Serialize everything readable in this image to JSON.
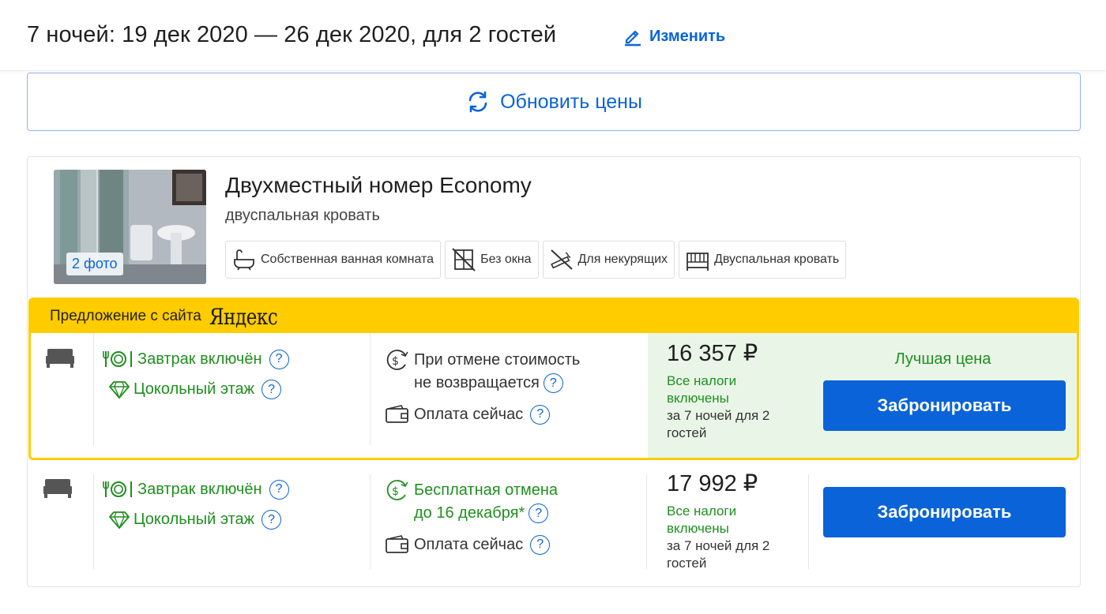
{
  "header": {
    "stay_summary": "7 ночей: 19 дек 2020 — 26 дек 2020, для 2 гостей",
    "change_label": "Изменить"
  },
  "refresh": {
    "label": "Обновить цены"
  },
  "room": {
    "title": "Двухместный номер Economy",
    "bed_type": "двуспальная кровать",
    "photo_badge": "2 фото",
    "amenities": [
      {
        "icon": "bathtub-icon",
        "label": "Собственная ванная комната"
      },
      {
        "icon": "no-window-icon",
        "label": "Без окна"
      },
      {
        "icon": "no-smoking-icon",
        "label": "Для некурящих"
      },
      {
        "icon": "double-bed-icon",
        "label": "Двуспальная кровать"
      }
    ]
  },
  "offers": [
    {
      "source_label": "Предложение с сайта",
      "source_brand": "Яндекс",
      "meal": "Завтрак включён",
      "floor": "Цокольный этаж",
      "cancel_line1": "При отмене стоимость",
      "cancel_line2": "не возвращается",
      "payment": "Оплата сейчас",
      "price": "16 357 ₽",
      "tax_note": "Все налоги включены",
      "nights_note": "за 7 ночей для 2 гостей",
      "best_price": "Лучшая цена",
      "book_label": "Забронировать"
    },
    {
      "meal": "Завтрак включён",
      "floor": "Цокольный этаж",
      "cancel_line1": "Бесплатная отмена",
      "cancel_line2": "до 16 декабря*",
      "payment": "Оплата сейчас",
      "price": "17 992 ₽",
      "tax_note": "Все налоги включены",
      "nights_note": "за 7 ночей для 2 гостей",
      "book_label": "Забронировать"
    }
  ],
  "colors": {
    "accent": "#0a63d8",
    "green": "#1f8f1f",
    "yandex_yellow": "#ffcc00",
    "best_price_bg": "#e9f6e7"
  }
}
